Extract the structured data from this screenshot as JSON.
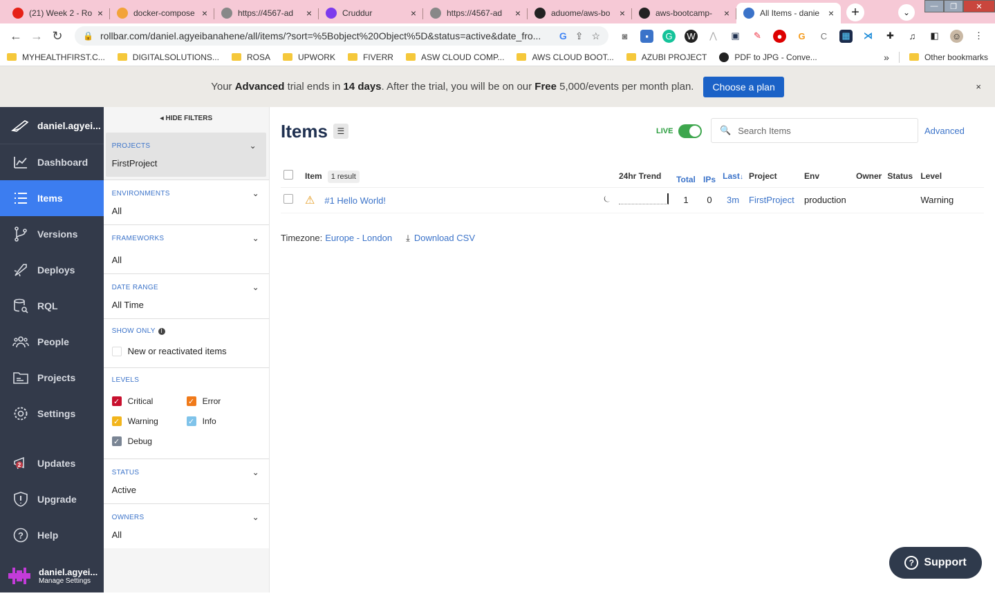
{
  "browser": {
    "tabs": [
      {
        "title": "(21) Week 2 - Ro",
        "fav_color": "#e62117",
        "active": false
      },
      {
        "title": "docker-compose",
        "fav_color": "#f2a33a",
        "active": false
      },
      {
        "title": "https://4567-ad",
        "fav_color": "#888888",
        "active": false
      },
      {
        "title": "Cruddur",
        "fav_color": "#7c3aed",
        "active": false
      },
      {
        "title": "https://4567-ad",
        "fav_color": "#888888",
        "active": false
      },
      {
        "title": "aduome/aws-bo",
        "fav_color": "#222222",
        "active": false
      },
      {
        "title": "aws-bootcamp-",
        "fav_color": "#222222",
        "active": false
      },
      {
        "title": "All Items - danie",
        "fav_color": "#3b73c9",
        "active": true
      }
    ],
    "url": "rollbar.com/daniel.agyeibanahene/all/items/?sort=%5Bobject%20Object%5D&status=active&date_fro...",
    "bookmarks": [
      "MYHEALTHFIRST.C...",
      "DIGITALSOLUTIONS...",
      "ROSA",
      "UPWORK",
      "FIVERR",
      "ASW CLOUD COMP...",
      "AWS CLOUD BOOT...",
      "AZUBI PROJECT",
      "PDF to JPG - Conve..."
    ],
    "other_bookmarks": "Other bookmarks",
    "overflow": "»"
  },
  "banner": {
    "pre": "Your ",
    "plan": "Advanced",
    "mid1": " trial ends in ",
    "days": "14 days",
    "mid2": ". After the trial, you will be on our ",
    "free": "Free",
    "post": " 5,000/events per month plan.",
    "cta": "Choose a plan",
    "close": "×"
  },
  "nav": {
    "brand": "daniel.agyei...",
    "items": [
      "Dashboard",
      "Items",
      "Versions",
      "Deploys",
      "RQL",
      "People",
      "Projects",
      "Settings"
    ],
    "bottom_items": [
      "Updates",
      "Upgrade",
      "Help"
    ],
    "updates_badge": "2",
    "user_name": "daniel.agyei...",
    "manage_settings": "Manage Settings"
  },
  "filters": {
    "hide": "HIDE FILTERS",
    "projects_label": "PROJECTS",
    "projects_value": "FirstProject",
    "environments_label": "ENVIRONMENTS",
    "environments_value": "All",
    "frameworks_label": "FRAMEWORKS",
    "frameworks_value": "All",
    "date_label": "DATE RANGE",
    "date_value": "All Time",
    "showonly_label": "SHOW ONLY",
    "showonly_option": "New or reactivated items",
    "levels_label": "LEVELS",
    "levels": [
      {
        "name": "Critical",
        "color": "#c8102e"
      },
      {
        "name": "Error",
        "color": "#f07a1a"
      },
      {
        "name": "Warning",
        "color": "#f2b51c"
      },
      {
        "name": "Info",
        "color": "#7fc3ea"
      },
      {
        "name": "Debug",
        "color": "#7a8594"
      }
    ],
    "status_label": "STATUS",
    "status_value": "Active",
    "owners_label": "OWNERS",
    "owners_value": "All"
  },
  "main": {
    "title": "Items",
    "live": "LIVE",
    "search_placeholder": "Search Items",
    "advanced": "Advanced",
    "columns": {
      "item": "Item",
      "result": "1 result",
      "trend": "24hr Trend",
      "total": "Total",
      "ips": "IPs",
      "last": "Last",
      "project": "Project",
      "env": "Env",
      "owner": "Owner",
      "status": "Status",
      "level": "Level"
    },
    "rows": [
      {
        "title": "#1 Hello World!",
        "total": "1",
        "ips": "0",
        "last": "3m",
        "project": "FirstProject",
        "env": "production",
        "owner": "",
        "status": "",
        "level": "Warning"
      }
    ],
    "timezone_label": "Timezone:",
    "timezone_value": "Europe - London",
    "download": "Download CSV",
    "support": "Support"
  }
}
